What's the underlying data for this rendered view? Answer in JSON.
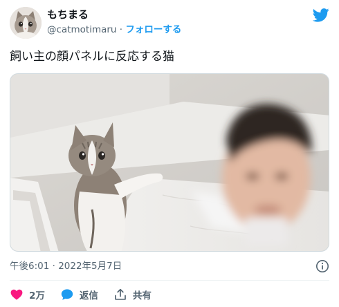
{
  "author": {
    "name": "もちまる",
    "handle": "@catmotimaru",
    "separator": "·",
    "follow_label": "フォローする"
  },
  "tweet": {
    "text": "飼い主の顔パネルに反応する猫",
    "timestamp": "午後6:01 · 2022年5月7日"
  },
  "actions": {
    "like_count": "2万",
    "reply_label": "返信",
    "share_label": "共有"
  },
  "colors": {
    "accent": "#1d9bf0",
    "like": "#f91880",
    "secondary_text": "#536471"
  },
  "icons": [
    "twitter-bird-icon",
    "info-icon",
    "heart-icon",
    "reply-bubble-icon",
    "share-icon"
  ]
}
